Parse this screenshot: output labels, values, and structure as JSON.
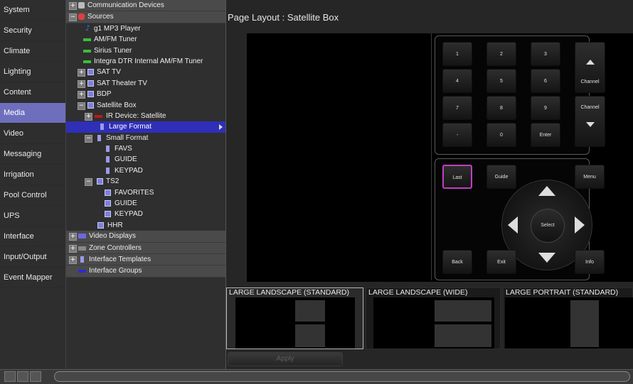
{
  "nav": {
    "items": [
      "System",
      "Security",
      "Climate",
      "Lighting",
      "Content",
      "Media",
      "Video",
      "Messaging",
      "Irrigation",
      "Pool Control",
      "UPS",
      "Interface",
      "Input/Output",
      "Event Mapper"
    ],
    "active": "Media"
  },
  "tree": {
    "rows": [
      {
        "label": "Communication Devices",
        "expander": "+",
        "icon": "comm-devices-icon",
        "band": true
      },
      {
        "label": "Sources",
        "expander": "−",
        "icon": "sources-icon",
        "band": true
      },
      {
        "label": "g1 MP3 Player",
        "icon": "music-note-icon"
      },
      {
        "label": "AM/FM Tuner",
        "icon": "tuner-icon"
      },
      {
        "label": "Sirius Tuner",
        "icon": "tuner-icon"
      },
      {
        "label": "Integra DTR Internal AM/FM Tuner",
        "icon": "tuner-icon"
      },
      {
        "label": "SAT TV",
        "expander": "+",
        "icon": "grid-icon"
      },
      {
        "label": "SAT Theater TV",
        "expander": "+",
        "icon": "grid-icon"
      },
      {
        "label": "BDP",
        "expander": "+",
        "icon": "grid-icon"
      },
      {
        "label": "Satellite Box",
        "expander": "−",
        "icon": "grid-icon"
      },
      {
        "label": "IR Device: Satellite",
        "expander": "+",
        "icon": "ir-device-icon"
      },
      {
        "label": "Large Format",
        "icon": "page-icon",
        "selected": true
      },
      {
        "label": "Small Format",
        "expander": "−",
        "icon": "page-icon"
      },
      {
        "label": "FAVS",
        "icon": "page-icon"
      },
      {
        "label": "GUIDE",
        "icon": "page-icon"
      },
      {
        "label": "KEYPAD",
        "icon": "page-icon"
      },
      {
        "label": "TS2",
        "expander": "−",
        "icon": "grid-icon"
      },
      {
        "label": "FAVORITES",
        "icon": "grid-icon"
      },
      {
        "label": "GUIDE",
        "icon": "grid-icon"
      },
      {
        "label": "KEYPAD",
        "icon": "grid-icon"
      },
      {
        "label": "HHR",
        "icon": "grid-icon"
      },
      {
        "label": "Video Displays",
        "expander": "+",
        "icon": "video-display-icon",
        "band": true
      },
      {
        "label": "Zone Controllers",
        "expander": "+",
        "icon": "zone-controller-icon",
        "band": true
      },
      {
        "label": "Interface Templates",
        "expander": "+",
        "icon": "page-icon",
        "band": true
      },
      {
        "label": "Interface Groups",
        "icon": "groups-icon",
        "band": true
      }
    ]
  },
  "main": {
    "title": "Page Layout : Satellite Box",
    "apply_label": "Apply"
  },
  "remote": {
    "keypad": [
      "1",
      "2",
      "3",
      "4",
      "5",
      "6",
      "7",
      "8",
      "9",
      "-",
      "0",
      "Enter"
    ],
    "channel_up": "Channel",
    "channel_down": "Channel",
    "last": "Last",
    "guide": "Guide",
    "menu": "Menu",
    "select": "Select",
    "back": "Back",
    "exit": "Exit",
    "info": "Info"
  },
  "layouts": [
    {
      "label": "LARGE LANDSCAPE (STANDARD)",
      "selected": true
    },
    {
      "label": "LARGE LANDSCAPE (WIDE)",
      "selected": false
    },
    {
      "label": "LARGE PORTRAIT (STANDARD)",
      "selected": false
    }
  ],
  "colors": {
    "nav_active": "#6d6fbd",
    "tree_selected": "#2f2fb8",
    "last_highlight": "#c040c0"
  }
}
